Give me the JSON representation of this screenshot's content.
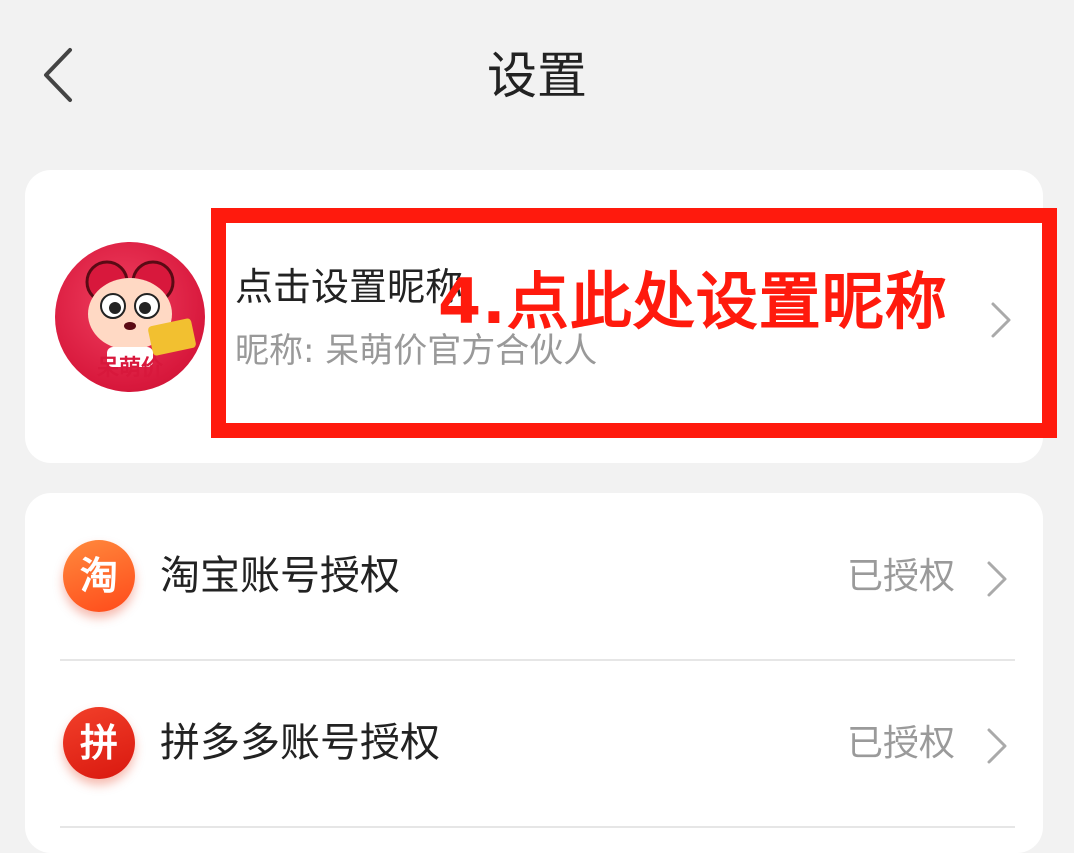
{
  "header": {
    "title": "设置",
    "back_icon": "chevron-left-icon"
  },
  "profile": {
    "avatar_icon": "mascot-avatar-icon",
    "avatar_logo_text": "呆萌价",
    "title": "点击设置昵称",
    "subtitle": "昵称: 呆萌价官方合伙人",
    "chevron_icon": "chevron-right-icon"
  },
  "annotation": {
    "text": "4.点此处设置昵称",
    "color": "#ff1a0d"
  },
  "auth_items": [
    {
      "icon_text": "淘",
      "icon_name": "taobao-icon",
      "label": "淘宝账号授权",
      "status": "已授权"
    },
    {
      "icon_text": "拼",
      "icon_name": "pinduoduo-icon",
      "label": "拼多多账号授权",
      "status": "已授权"
    }
  ],
  "colors": {
    "background": "#f2f2f2",
    "card": "#ffffff",
    "accent": "#ff1a0d"
  }
}
